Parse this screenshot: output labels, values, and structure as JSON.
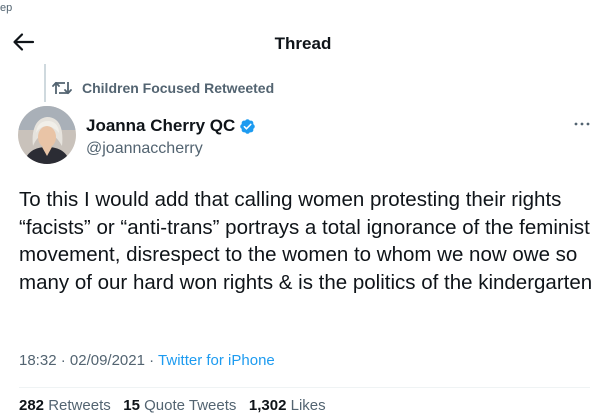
{
  "top_fragment": "ep",
  "header": {
    "title": "Thread"
  },
  "retweet": {
    "label": "Children Focused Retweeted"
  },
  "author": {
    "name": "Joanna Cherry QC",
    "handle": "@joannaccherry",
    "verified": true
  },
  "tweet": {
    "text": "To this I would add that calling women protesting their rights “facists” or “anti-trans” portrays a total ignorance of the feminist movement, disrespect to the women to whom we now owe so many of our hard won rights & is the politics of the kindergarten",
    "time": "18:32",
    "separator": " · ",
    "date": "02/09/2021",
    "app": "Twitter for iPhone"
  },
  "stats": {
    "retweets_count": "282",
    "retweets_label": "Retweets",
    "quotes_count": "15",
    "quotes_label": "Quote Tweets",
    "likes_count": "1,302",
    "likes_label": "Likes"
  },
  "colors": {
    "accent": "#1d9bf0",
    "secondary_text": "#536471",
    "primary_text": "#0f1419"
  },
  "icons": {
    "back": "back-arrow-icon",
    "retweet": "retweet-icon",
    "verified": "verified-badge-icon",
    "more": "more-options-icon"
  }
}
